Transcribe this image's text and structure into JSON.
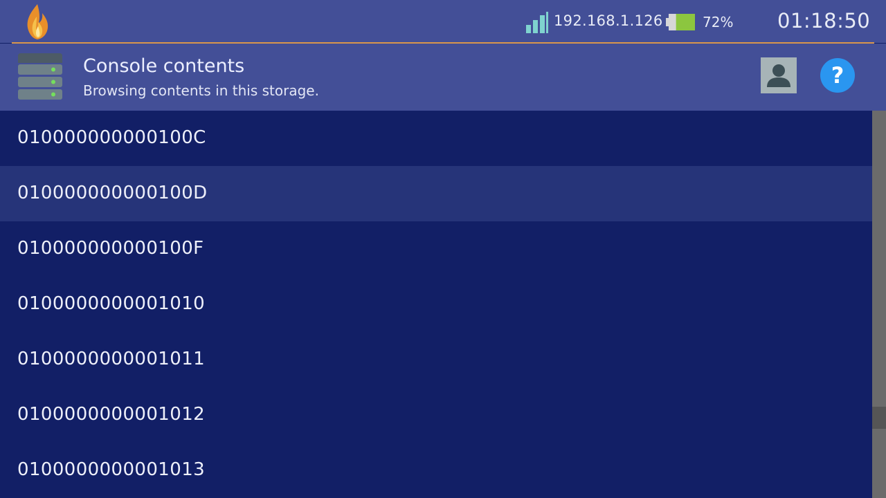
{
  "status_bar": {
    "ip_address": "192.168.1.126",
    "battery_percent": "72%",
    "battery_level": 0.72,
    "time": "01:18:50",
    "icons": [
      "flame-logo-icon",
      "wifi-signal-icon",
      "battery-icon"
    ]
  },
  "header": {
    "title": "Console contents",
    "subtitle": "Browsing contents in this storage.",
    "icons": [
      "storage-icon",
      "user-icon",
      "help-icon"
    ],
    "help_glyph": "?"
  },
  "list": {
    "items": [
      {
        "label": "010000000000100C",
        "selected": false
      },
      {
        "label": "010000000000100D",
        "selected": true
      },
      {
        "label": "010000000000100F",
        "selected": false
      },
      {
        "label": "0100000000001010",
        "selected": false
      },
      {
        "label": "0100000000001011",
        "selected": false
      },
      {
        "label": "0100000000001012",
        "selected": false
      },
      {
        "label": "0100000000001013",
        "selected": false
      }
    ]
  },
  "colors": {
    "topbar_bg": "#434f97",
    "accent_line": "#d9964a",
    "list_bg": "#121f66",
    "selected_row_bg": "#263479",
    "help_button": "#2a96f0",
    "battery_fill": "#8cc63f"
  }
}
